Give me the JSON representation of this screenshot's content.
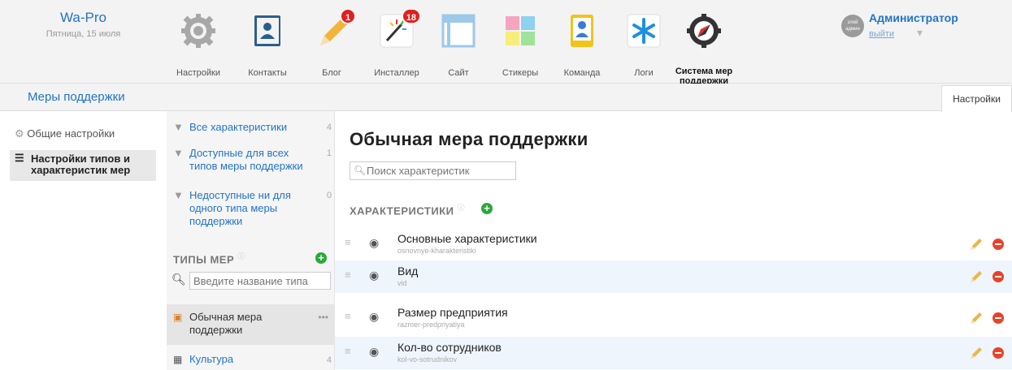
{
  "brand": {
    "name": "Wa-Pro",
    "date": "Пятница, 15 июля"
  },
  "apps": [
    {
      "label": "Настройки",
      "icon": "gear-icon",
      "badge": ""
    },
    {
      "label": "Контакты",
      "icon": "contacts-icon",
      "badge": ""
    },
    {
      "label": "Блог",
      "icon": "pencil-icon",
      "badge": "1"
    },
    {
      "label": "Инсталлер",
      "icon": "installer-icon",
      "badge": "18"
    },
    {
      "label": "Сайт",
      "icon": "site-icon",
      "badge": ""
    },
    {
      "label": "Стикеры",
      "icon": "stickers-icon",
      "badge": ""
    },
    {
      "label": "Команда",
      "icon": "team-icon",
      "badge": ""
    },
    {
      "label": "Логи",
      "icon": "logs-icon",
      "badge": ""
    },
    {
      "label": "Система мер поддержки",
      "icon": "compass-icon",
      "badge": ""
    }
  ],
  "user": {
    "name": "Администратор",
    "logout": "выйти",
    "avatar_text": "злой админ"
  },
  "subbar": {
    "title": "Меры поддержки",
    "tab": "Настройки"
  },
  "left_nav": {
    "general": "Общие настройки",
    "types": "Настройки типов и характеристик мер"
  },
  "filters": [
    {
      "label": "Все характеристики",
      "count": "4"
    },
    {
      "label": "Доступные для всех типов меры поддержки",
      "count": "1"
    },
    {
      "label": "Недоступные ни для одного типа меры поддержки",
      "count": "0"
    }
  ],
  "types_section": {
    "title": "ТИПЫ МЕР",
    "search_placeholder": "Введите название типа"
  },
  "types": [
    {
      "label": "Обычная мера поддержки",
      "count": "",
      "more": "•••"
    },
    {
      "label": "Культура",
      "count": "4",
      "more": ""
    }
  ],
  "main": {
    "title": "Обычная мера поддержки",
    "search_placeholder": "Поиск характеристик",
    "section": "ХАРАКТЕРИСТИКИ"
  },
  "characteristics": [
    {
      "name": "Основные характеристики",
      "code": "osnovnye-kharakteristiki"
    },
    {
      "name": "Вид",
      "code": "vid"
    },
    {
      "name": "Размер предприятия",
      "code": "razmer-predpriyatiya"
    },
    {
      "name": "Кол-во сотрудников",
      "code": "kol-vo-sotrudnikov"
    }
  ],
  "colors": {
    "accent": "#2374c6",
    "add": "#29a83a",
    "delete": "#e8432a",
    "badge": "#e02020"
  }
}
